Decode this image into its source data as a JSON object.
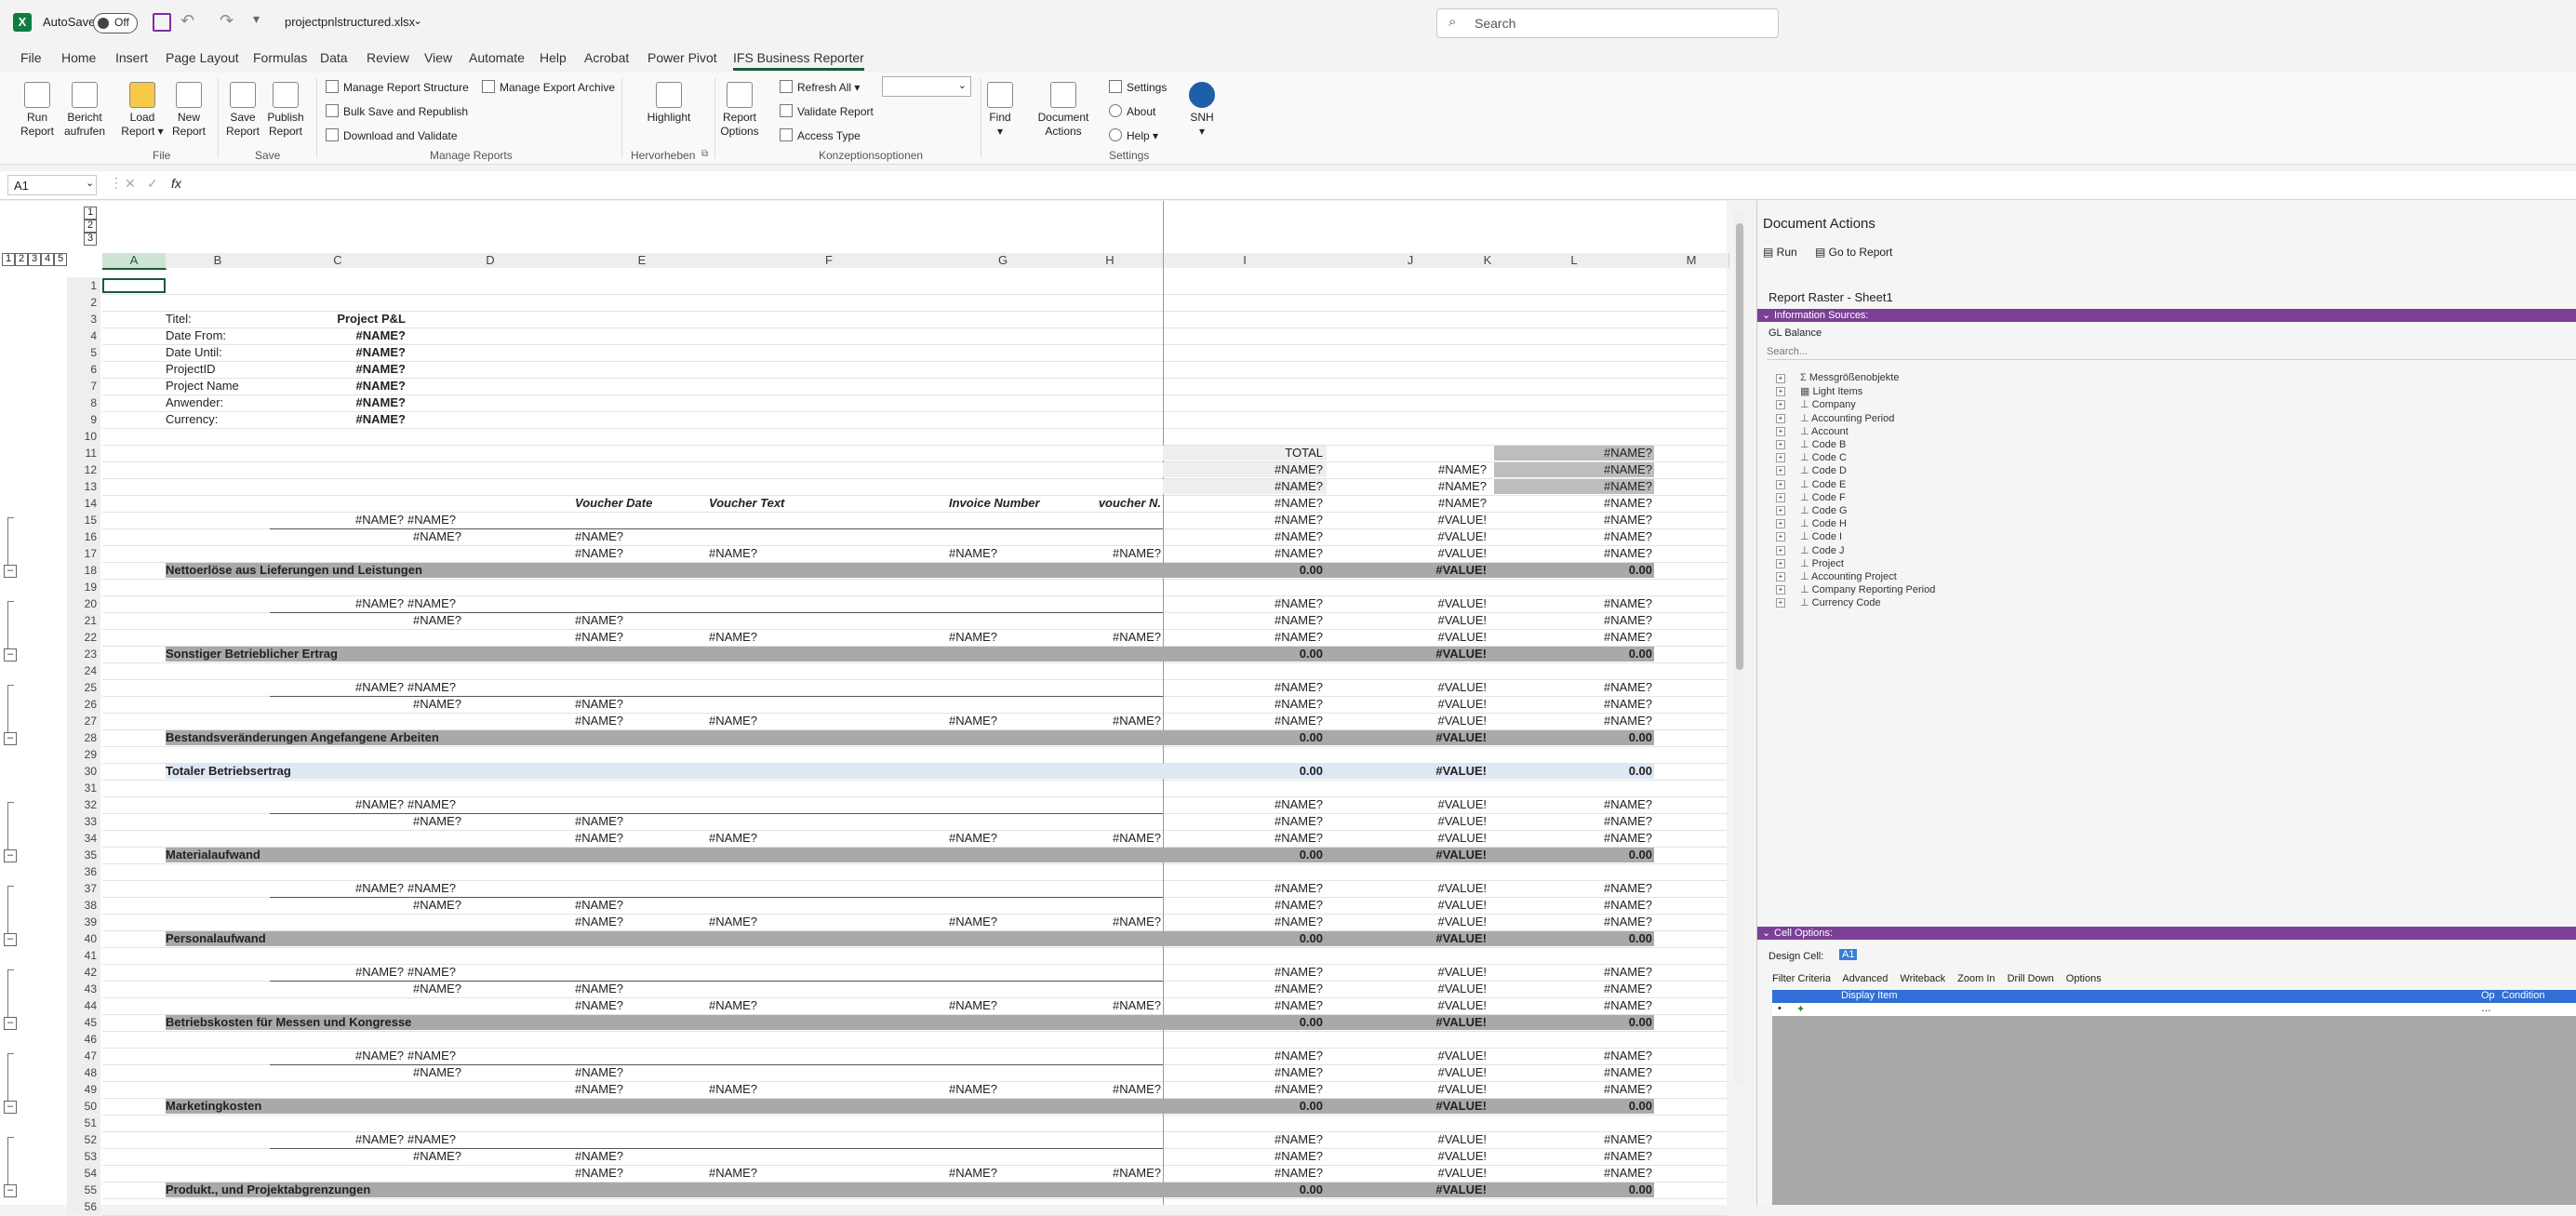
{
  "titlebar": {
    "autosave_label": "AutoSave",
    "autosave_state": "Off",
    "filename": "projectpnlstructured.xlsx",
    "search_placeholder": "Search"
  },
  "menu": [
    "File",
    "Home",
    "Insert",
    "Page Layout",
    "Formulas",
    "Data",
    "Review",
    "View",
    "Automate",
    "Help",
    "Acrobat",
    "Power Pivot",
    "IFS Business Reporter"
  ],
  "ribbon": {
    "run_report": [
      "Run",
      "Report"
    ],
    "bericht": [
      "Bericht",
      "aufrufen"
    ],
    "load_report": [
      "Load",
      "Report"
    ],
    "new_report": [
      "New",
      "Report"
    ],
    "save_report": [
      "Save",
      "Report"
    ],
    "publish_report": [
      "Publish",
      "Report"
    ],
    "manage_structure": "Manage Report Structure",
    "manage_export": "Manage Export Archive",
    "bulk_save": "Bulk Save and Republish",
    "download_validate": "Download and Validate",
    "highlight": "Highlight",
    "report_options": [
      "Report",
      "Options"
    ],
    "refresh_all": "Refresh All",
    "validate_report": "Validate Report",
    "access_type": "Access Type",
    "find": "Find",
    "document_actions": [
      "Document",
      "Actions"
    ],
    "settings": "Settings",
    "about": "About",
    "help": "Help",
    "user": "SNH",
    "groups": {
      "file": "File",
      "save": "Save",
      "manage": "Manage Reports",
      "hervorheben": "Hervorheben",
      "konzeption": "Konzeptionsoptionen",
      "settings": "Settings"
    }
  },
  "formula": {
    "namebox": "A1",
    "fx": "fx"
  },
  "columns": [
    "A",
    "B",
    "C",
    "D",
    "E",
    "F",
    "G",
    "H",
    "I",
    "J",
    "K",
    "L",
    "M"
  ],
  "outline_levels": [
    "1",
    "2",
    "3",
    "4",
    "5"
  ],
  "header_block": {
    "labels": [
      "Titel:",
      "Date From:",
      "Date Until:",
      "ProjectID",
      "Project Name",
      "Anwender:",
      "Currency:"
    ],
    "values": [
      "Project P&L",
      "#NAME?",
      "#NAME?",
      "#NAME?",
      "#NAME?",
      "#NAME?",
      "#NAME?"
    ]
  },
  "total_label": "TOTAL",
  "col_headers": {
    "voucher_date": "Voucher Date",
    "voucher_text": "Voucher Text",
    "invoice_number": "Invoice Number",
    "voucher_n": "voucher N."
  },
  "err": {
    "name": "#NAME?",
    "value": "#VALUE!",
    "zero": "0.00"
  },
  "sections": [
    {
      "start": 15,
      "title": "Nettoerlöse aus Lieferungen und Leistungen",
      "row": 18
    },
    {
      "start": 20,
      "title": "Sonstiger Betrieblicher Ertrag",
      "row": 23
    },
    {
      "start": 25,
      "title": "Bestandsveränderungen Angefangene Arbeiten",
      "row": 28
    },
    {
      "start": 32,
      "title": "Materialaufwand",
      "row": 35
    },
    {
      "start": 37,
      "title": "Personalaufwand",
      "row": 40
    },
    {
      "start": 42,
      "title": "Betriebskosten für Messen und Kongresse",
      "row": 45
    },
    {
      "start": 47,
      "title": "Marketingkosten",
      "row": 50
    },
    {
      "start": 52,
      "title": "Produkt., und Projektabgrenzungen",
      "row": 55
    }
  ],
  "totaler": {
    "title": "Totaler Betriebsertrag",
    "row": 30
  },
  "pane": {
    "title": "Document Actions",
    "run": "Run",
    "goto": "Go to Report",
    "raster": "Report Raster - Sheet1",
    "info_sources": "Information Sources:",
    "source": "GL Balance",
    "search": "Search...",
    "tree": [
      "Messgrößenobjekte",
      "Light Items",
      "Company",
      "Accounting Period",
      "Account",
      "Code B",
      "Code C",
      "Code D",
      "Code E",
      "Code F",
      "Code G",
      "Code H",
      "Code I",
      "Code J",
      "Project",
      "Accounting Project",
      "Company Reporting Period",
      "Currency Code"
    ],
    "cell_options": "Cell Options:",
    "design_cell_label": "Design Cell:",
    "design_cell_value": "A1",
    "tabs": [
      "Filter Criteria",
      "Advanced",
      "Writeback",
      "Zoom In",
      "Drill Down",
      "Options"
    ],
    "grid_headers": [
      "Display Item",
      "Op",
      "Condition"
    ]
  }
}
